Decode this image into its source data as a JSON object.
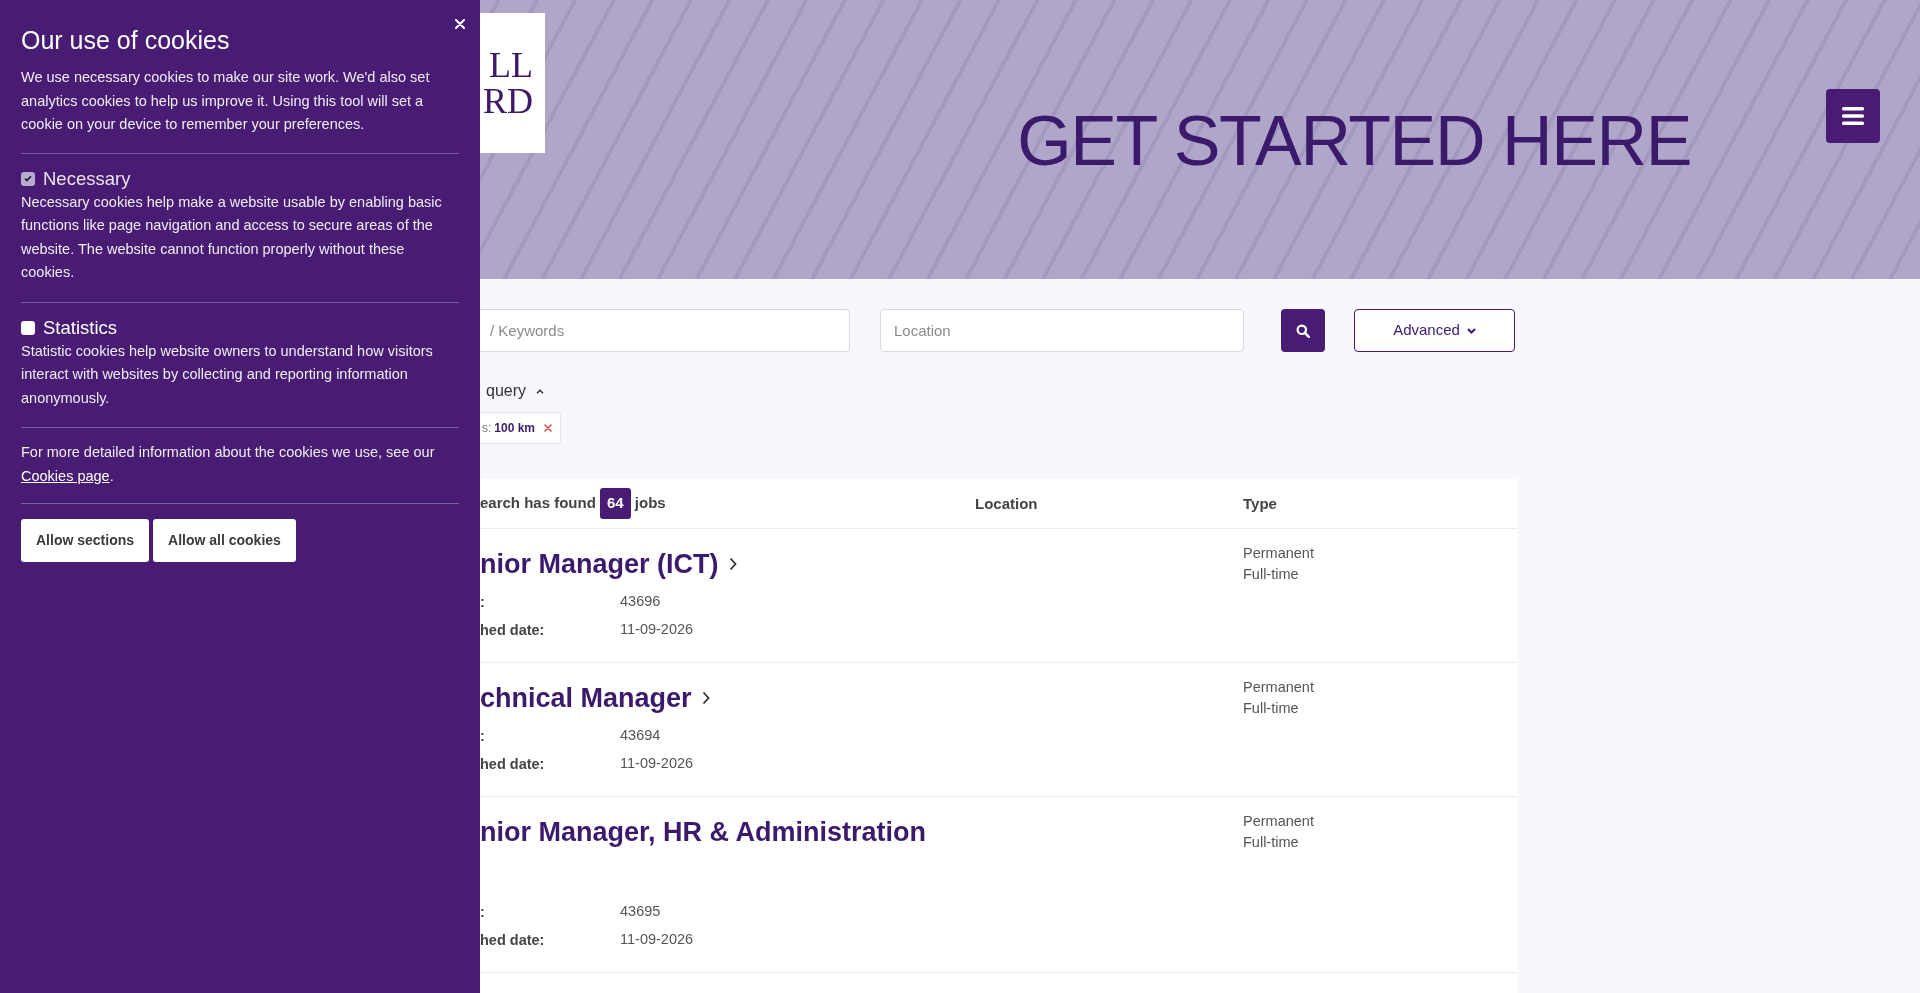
{
  "cookie_panel": {
    "title": "Our use of cookies",
    "intro": "We use necessary cookies to make our site work. We'd also set analytics cookies to help us improve it. Using this tool will set a cookie on your device to remember your preferences.",
    "sections": [
      {
        "label": "Necessary",
        "checked": true,
        "disabled": true,
        "description": "Necessary cookies help make a website usable by enabling basic functions like page navigation and access to secure areas of the website. The website cannot function properly without these cookies."
      },
      {
        "label": "Statistics",
        "checked": false,
        "disabled": false,
        "description": "Statistic cookies help website owners to understand how visitors interact with websites by collecting and reporting information anonymously."
      }
    ],
    "more_info": {
      "text": "For more detailed information about the cookies we use, see our",
      "link": "Cookies page",
      "after": "."
    },
    "buttons": [
      "Allow sections",
      "Allow all cookies"
    ]
  },
  "header": {
    "logo": [
      "LL",
      "RD"
    ],
    "banner_title": "GET STARTED HERE"
  },
  "search": {
    "keywords": {
      "placeholder": "/ Keywords"
    },
    "location": {
      "placeholder": "Location"
    },
    "advanced": {
      "label": "Advanced",
      "expanded": false
    }
  },
  "query": {
    "label": "query",
    "expanded": true,
    "filters": [
      {
        "label": "s:",
        "value": "100 km"
      }
    ]
  },
  "results": {
    "summary": "earch has found",
    "count": "64",
    "unit": "jobs",
    "columns": [
      "Location",
      "Type"
    ],
    "rows": [
      {
        "title": "nior Manager (ICT)",
        "arrow": true,
        "fields": [
          {
            "label": ":",
            "value": "43696"
          },
          {
            "label": "hed date:",
            "value": "11-09-2026"
          }
        ],
        "type": [
          "Permanent",
          "Full-time"
        ]
      },
      {
        "title": "chnical Manager",
        "arrow": true,
        "fields": [
          {
            "label": ":",
            "value": "43694"
          },
          {
            "label": "hed date:",
            "value": "11-09-2026"
          }
        ],
        "type": [
          "Permanent",
          "Full-time"
        ]
      },
      {
        "title": "nior Manager, HR & Administration",
        "arrow": false,
        "fields": [
          {
            "label": ":",
            "value": "43695"
          },
          {
            "label": "hed date:",
            "value": "11-09-2026"
          }
        ],
        "type": [
          "Permanent",
          "Full-time"
        ]
      }
    ]
  }
}
